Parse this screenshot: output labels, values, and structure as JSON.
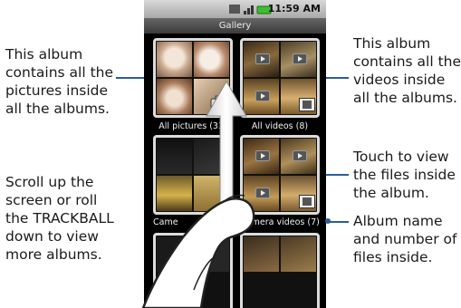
{
  "annotations": {
    "all_pictures_line1": "This album",
    "all_pictures_line2": "contains all the",
    "all_pictures_line3": "pictures inside",
    "all_pictures_line4": "all the albums.",
    "scroll_line1": "Scroll up the",
    "scroll_line2": "screen or roll",
    "scroll_line3": "the TRACKBALL",
    "scroll_line4": "down to view",
    "scroll_line5": "more albums.",
    "all_videos_line1": "This album",
    "all_videos_line2": "contains all the",
    "all_videos_line3": "videos inside",
    "all_videos_line4": "all the albums.",
    "touch_line1": "Touch to view",
    "touch_line2": "the files inside",
    "touch_line3": "the album.",
    "album_name_line1": "Album name",
    "album_name_line2": "and number of",
    "album_name_line3": "files inside."
  },
  "statusbar": {
    "time": "11:59 AM"
  },
  "app": {
    "title": "Gallery"
  },
  "albums": [
    {
      "label": "All pictures (33)"
    },
    {
      "label": "All videos (8)"
    },
    {
      "label": "Came"
    },
    {
      "label": "Camera videos (7)"
    }
  ],
  "colors": {
    "leader": "#2a5e98",
    "phone_bg": "#000000",
    "album_border": "#dcdcdc"
  }
}
